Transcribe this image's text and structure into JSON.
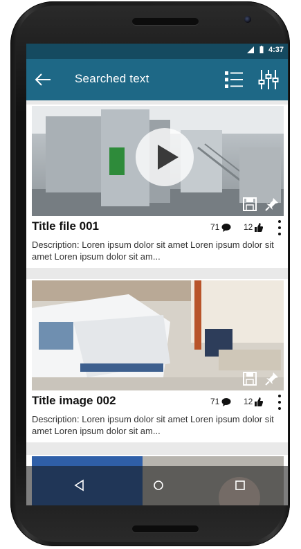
{
  "status_bar": {
    "time": "4:37"
  },
  "app_bar": {
    "title": "Searched text"
  },
  "cards": [
    {
      "title": "Title file 001",
      "comments": "71",
      "likes": "12",
      "description": "Description: Loren ipsum dolor sit amet Loren ipsum dolor sit amet Loren ipsum dolor sit am...",
      "type": "video"
    },
    {
      "title": "Title image 002",
      "comments": "71",
      "likes": "12",
      "description": "Description: Loren ipsum dolor sit amet Loren ipsum dolor sit amet Loren ipsum dolor sit am...",
      "type": "image"
    }
  ],
  "icons": {
    "back": "arrow-left-icon",
    "list": "list-view-icon",
    "filter": "sliders-icon",
    "play": "play-icon",
    "save": "save-icon",
    "pin": "pin-icon",
    "comment": "comment-icon",
    "like": "thumbs-up-icon",
    "more": "more-vertical-icon",
    "nav_back": "nav-back-icon",
    "nav_home": "nav-home-icon",
    "nav_recent": "nav-recent-icon",
    "signal": "signal-icon",
    "battery": "battery-icon"
  },
  "colors": {
    "app_bar": "#1e6886",
    "status_bar": "#154a60",
    "background": "#e9e9e9"
  }
}
